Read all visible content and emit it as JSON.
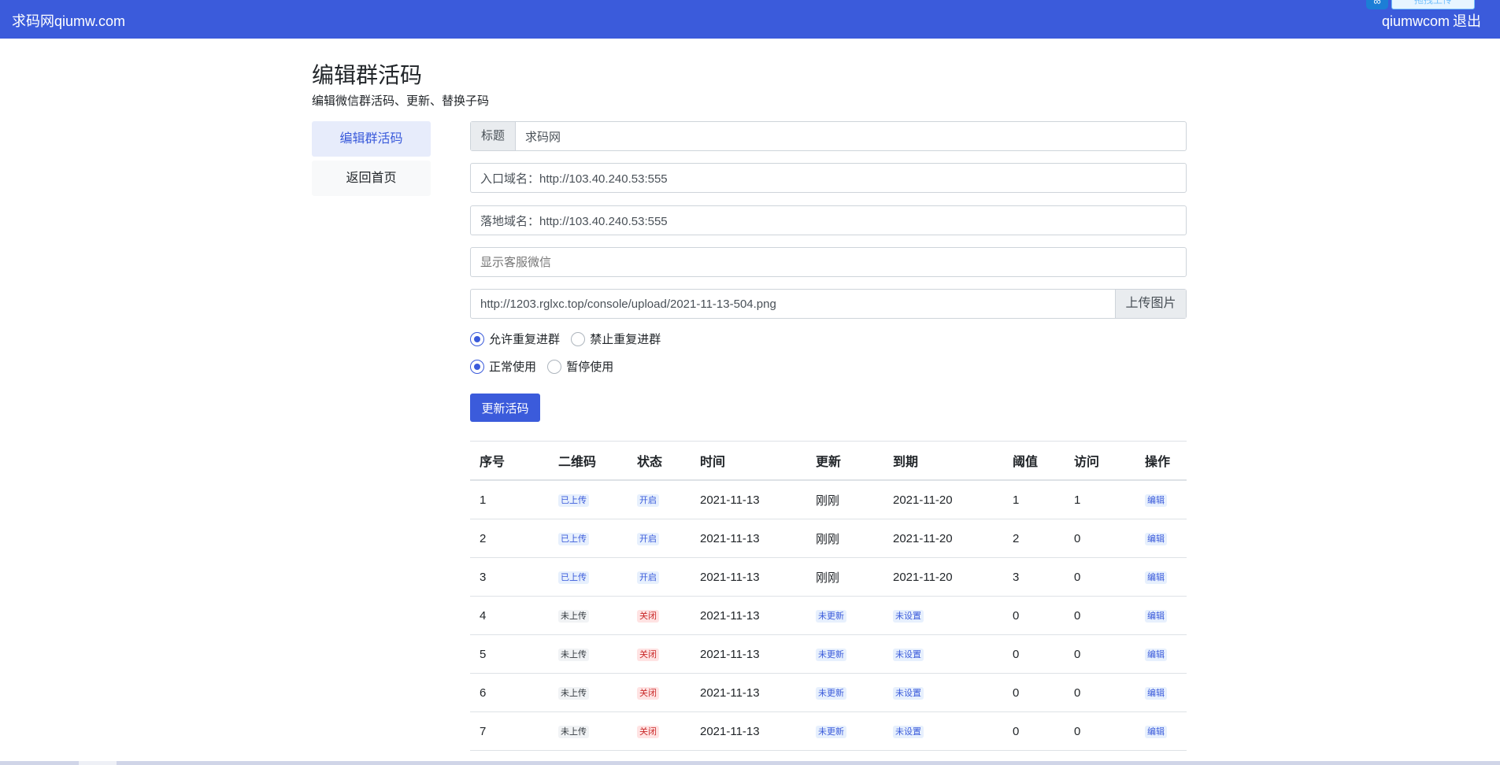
{
  "navbar": {
    "brand": "求码网qiumw.com",
    "user": "qiumwcom",
    "logout": "退出",
    "upload_badge": "拖拽上传",
    "upload_logo": "∞"
  },
  "page": {
    "title": "编辑群活码",
    "subtitle": "编辑微信群活码、更新、替换子码"
  },
  "sidebar": {
    "items": [
      {
        "label": "编辑群活码"
      },
      {
        "label": "返回首页"
      }
    ]
  },
  "form": {
    "title_label": "标题",
    "title_value": "求码网",
    "entry_domain": "入口域名：http://103.40.240.53:555",
    "landing_domain": "落地域名：http://103.40.240.53:555",
    "kefu_placeholder": "显示客服微信",
    "image_url": "http://1203.rglxc.top/console/upload/2021-11-13-504.png",
    "upload_label": "上传图片",
    "repeat_allow": "允许重复进群",
    "repeat_deny": "禁止重复进群",
    "status_normal": "正常使用",
    "status_pause": "暂停使用",
    "submit_label": "更新活码"
  },
  "table": {
    "headers": [
      "序号",
      "二维码",
      "状态",
      "时间",
      "更新",
      "到期",
      "阈值",
      "访问",
      "操作"
    ],
    "rows": [
      {
        "no": "1",
        "qr": "已上传",
        "state": "开启",
        "time": "2021-11-13",
        "update": "刚刚",
        "expire": "2021-11-20",
        "threshold": "1",
        "visits": "1",
        "action": "编辑"
      },
      {
        "no": "2",
        "qr": "已上传",
        "state": "开启",
        "time": "2021-11-13",
        "update": "刚刚",
        "expire": "2021-11-20",
        "threshold": "2",
        "visits": "0",
        "action": "编辑"
      },
      {
        "no": "3",
        "qr": "已上传",
        "state": "开启",
        "time": "2021-11-13",
        "update": "刚刚",
        "expire": "2021-11-20",
        "threshold": "3",
        "visits": "0",
        "action": "编辑"
      },
      {
        "no": "4",
        "qr": "未上传",
        "state": "关闭",
        "time": "2021-11-13",
        "update": "未更新",
        "expire": "未设置",
        "threshold": "0",
        "visits": "0",
        "action": "编辑"
      },
      {
        "no": "5",
        "qr": "未上传",
        "state": "关闭",
        "time": "2021-11-13",
        "update": "未更新",
        "expire": "未设置",
        "threshold": "0",
        "visits": "0",
        "action": "编辑"
      },
      {
        "no": "6",
        "qr": "未上传",
        "state": "关闭",
        "time": "2021-11-13",
        "update": "未更新",
        "expire": "未设置",
        "threshold": "0",
        "visits": "0",
        "action": "编辑"
      },
      {
        "no": "7",
        "qr": "未上传",
        "state": "关闭",
        "time": "2021-11-13",
        "update": "未更新",
        "expire": "未设置",
        "threshold": "0",
        "visits": "0",
        "action": "编辑"
      }
    ]
  }
}
